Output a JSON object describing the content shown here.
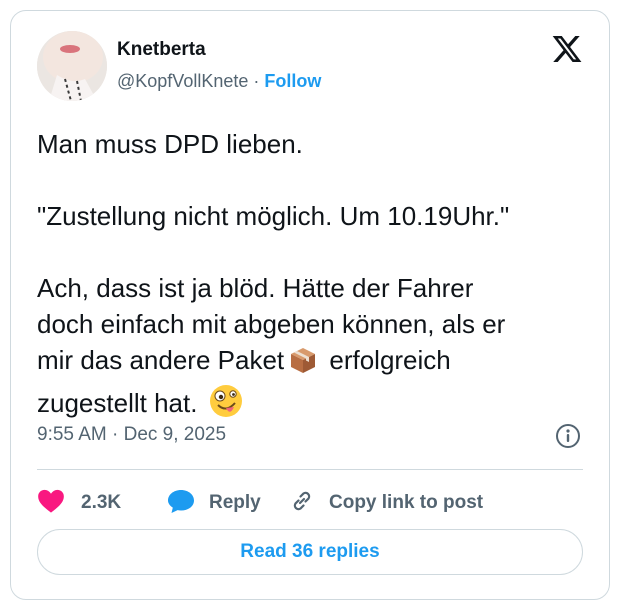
{
  "author": {
    "name": "Knetberta",
    "handle": "@KopfVollKnete",
    "separator": "·",
    "follow_label": "Follow"
  },
  "tweet": {
    "line1": "Man muss DPD lieben.",
    "line2": "\"Zustellung nicht möglich. Um 10.19Uhr.\"",
    "line3_before_emoji": "Ach, dass ist ja blöd. Hätte der Fahrer\ndoch einfach mit abgeben können, als er\nmir das andere Paket",
    "line3_after_emoji": " erfolgreich\nzugestellt hat.",
    "emojis": [
      "package-emoji",
      "zany-face-emoji"
    ]
  },
  "meta": {
    "timestamp": "9:55 AM · Dec 9, 2025"
  },
  "actions": {
    "like_count": "2.3K",
    "reply_label": "Reply",
    "copy_label": "Copy link to post"
  },
  "read_replies_label": "Read 36 replies",
  "colors": {
    "accent": "#1d9bf0",
    "like": "#f91880",
    "text": "#0f1419",
    "muted": "#536471",
    "border": "#cfd9de"
  },
  "icons": [
    "x-logo-icon",
    "info-icon",
    "heart-icon",
    "reply-bubble-icon",
    "link-icon"
  ]
}
